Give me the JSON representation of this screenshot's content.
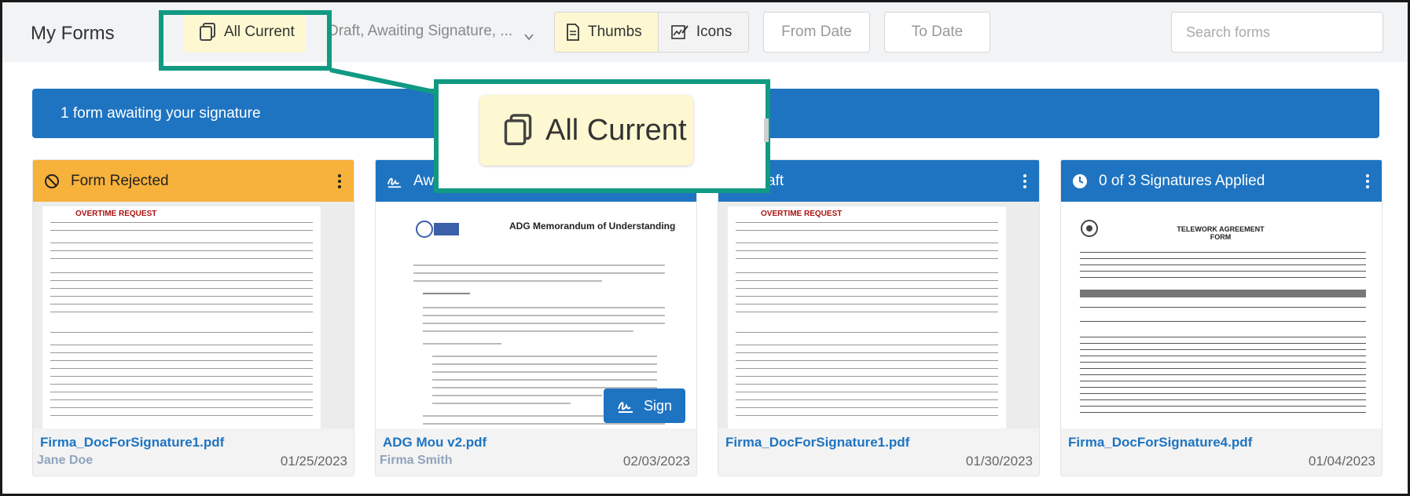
{
  "header": {
    "title": "My Forms",
    "all_current_label": "All Current",
    "status_filter_value": "Draft, Awaiting Signature, ...",
    "view_thumbs_label": "Thumbs",
    "view_icons_label": "Icons",
    "from_date_placeholder": "From Date",
    "to_date_placeholder": "To Date",
    "search_placeholder": "Search forms"
  },
  "banner": {
    "text": "1 form awaiting your signature"
  },
  "cards": [
    {
      "status": "Form Rejected",
      "file": "Firma_DocForSignature1.pdf",
      "user": "Jane Doe",
      "date": "01/25/2023",
      "doc_title": "OVERTIME REQUEST"
    },
    {
      "status": "Awaiting Signature",
      "status_visible": "Awa",
      "file": "ADG Mou v2.pdf",
      "user": "Firma Smith",
      "date": "02/03/2023",
      "doc_title": "ADG Memorandum of Understanding",
      "sign_label": "Sign"
    },
    {
      "status_visible": "aft",
      "file": "Firma_DocForSignature1.pdf",
      "user": "",
      "date": "01/30/2023",
      "doc_title": "OVERTIME REQUEST"
    },
    {
      "status": "0 of 3 Signatures Applied",
      "file": "Firma_DocForSignature4.pdf",
      "user": "",
      "date": "01/04/2023",
      "doc_title": "TELEWORK AGREEMENT FORM"
    }
  ],
  "callout": {
    "zoom_label": "All Current"
  },
  "colors": {
    "accent_blue": "#1e74c1",
    "rejected_orange": "#f7b23b",
    "highlight_yellow": "#fdf8d2",
    "callout_green": "#119a82"
  }
}
